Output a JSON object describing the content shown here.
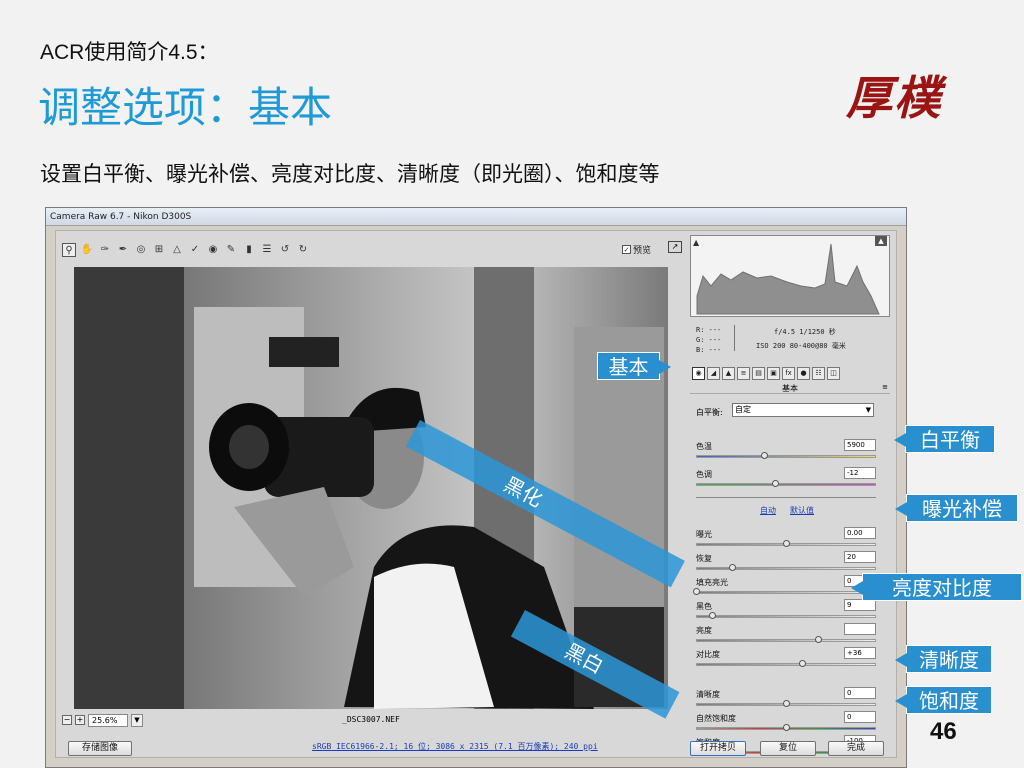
{
  "slide": {
    "heading": "ACR使用简介4.5：",
    "title": "调整选项：基本",
    "logo": "厚樸",
    "subtitle": "设置白平衡、曝光补偿、亮度对比度、清晰度（即光圈）、饱和度等",
    "page_number": "46"
  },
  "window": {
    "title": "Camera Raw 6.7 -  Nikon D300S",
    "preview_label": "预览",
    "zoom": "25.6%",
    "filename": "_DSC3007.NEF",
    "workflow": "sRGB IEC61966-2.1; 16 位;  3086 x 2315 (7.1 百万像素); 240 ppi",
    "buttons": {
      "save": "存储图像",
      "open_copy": "打开拷贝",
      "reset": "复位",
      "done": "完成"
    }
  },
  "info": {
    "r": "R:  ---",
    "g": "G:  ---",
    "b": "B:  ---",
    "cam1": "f/4.5  1/1250 秒",
    "cam2": "ISO 200  80-400@80 毫米"
  },
  "panel": {
    "name": "基本",
    "wb_label": "白平衡:",
    "wb_value": "自定",
    "auto_link": "自动",
    "default_link": "默认值",
    "sliders": [
      {
        "id": "temp",
        "label": "色温",
        "value": "5900",
        "level": 0.38
      },
      {
        "id": "tint",
        "label": "色调",
        "value": "-12",
        "level": 0.44
      },
      {
        "id": "exposure",
        "label": "曝光",
        "value": "0.00",
        "level": 0.5
      },
      {
        "id": "recovery",
        "label": "恢复",
        "value": "20",
        "level": 0.2
      },
      {
        "id": "fill",
        "label": "填充亮光",
        "value": "0",
        "level": 0.0
      },
      {
        "id": "blacks",
        "label": "黑色",
        "value": "9",
        "level": 0.09
      },
      {
        "id": "brightness",
        "label": "亮度",
        "value": "",
        "level": 0.68
      },
      {
        "id": "contrast",
        "label": "对比度",
        "value": "+36",
        "level": 0.59
      },
      {
        "id": "clarity",
        "label": "清晰度",
        "value": "0",
        "level": 0.5
      },
      {
        "id": "vibrance",
        "label": "自然饱和度",
        "value": "0",
        "level": 0.5
      },
      {
        "id": "saturation",
        "label": "饱和度",
        "value": "-100",
        "level": 0.0
      }
    ]
  },
  "callouts": {
    "basic": "基本",
    "white_balance": "白平衡",
    "exposure": "曝光补偿",
    "brightness_contrast": "亮度对比度",
    "clarity": "清晰度",
    "saturation": "饱和度",
    "blacken": "黑化",
    "bw": "黑白"
  },
  "colors": {
    "title_blue": "#1e9ad6",
    "callout_blue": "#2a8fcf",
    "logo_red": "#9b1414"
  }
}
